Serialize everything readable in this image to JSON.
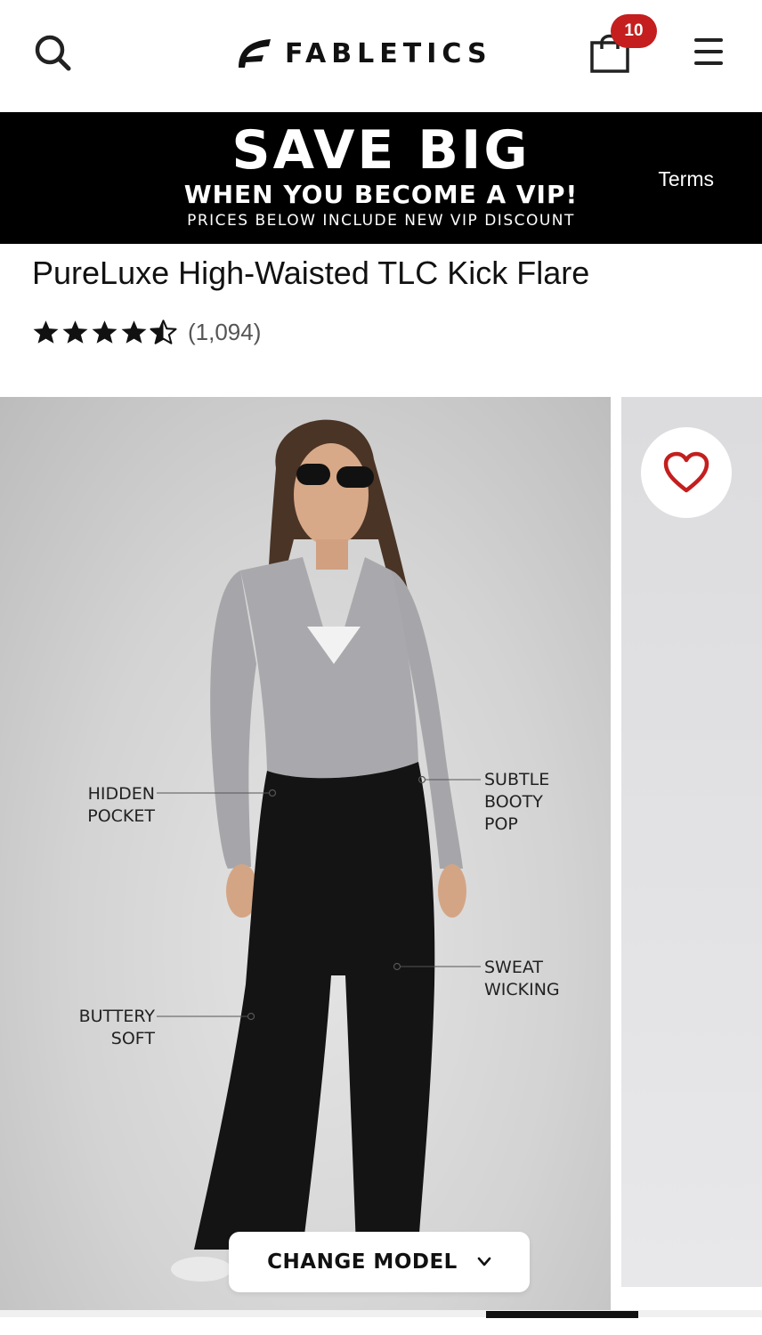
{
  "header": {
    "brand": "FABLETICS",
    "cart_count": "10"
  },
  "promo": {
    "headline": "SAVE BIG",
    "subheadline": "WHEN YOU BECOME A VIP!",
    "fine_print": "PRICES BELOW INCLUDE NEW VIP DISCOUNT",
    "terms_link": "Terms"
  },
  "product": {
    "title": "PureLuxe High-Waisted TLC Kick Flare",
    "rating": 4.5,
    "review_count": "(1,094)"
  },
  "gallery": {
    "callouts": {
      "hidden_pocket": "HIDDEN POCKET",
      "subtle_booty_pop": "SUBTLE BOOTY POP",
      "sweat_wicking": "SWEAT WICKING",
      "buttery_soft": "BUTTERY SOFT"
    },
    "change_model_label": "CHANGE MODEL",
    "carousel_progress": 0.2
  },
  "icons": {
    "search": "search-icon",
    "logo": "fabletics-logo-icon",
    "cart": "shopping-bag-icon",
    "menu": "hamburger-menu-icon",
    "favorite": "heart-icon",
    "dropdown": "chevron-down-icon"
  },
  "colors": {
    "banner_bg": "#000000",
    "badge": "#c41e1e",
    "heart": "#c41e1e",
    "text": "#111111"
  }
}
